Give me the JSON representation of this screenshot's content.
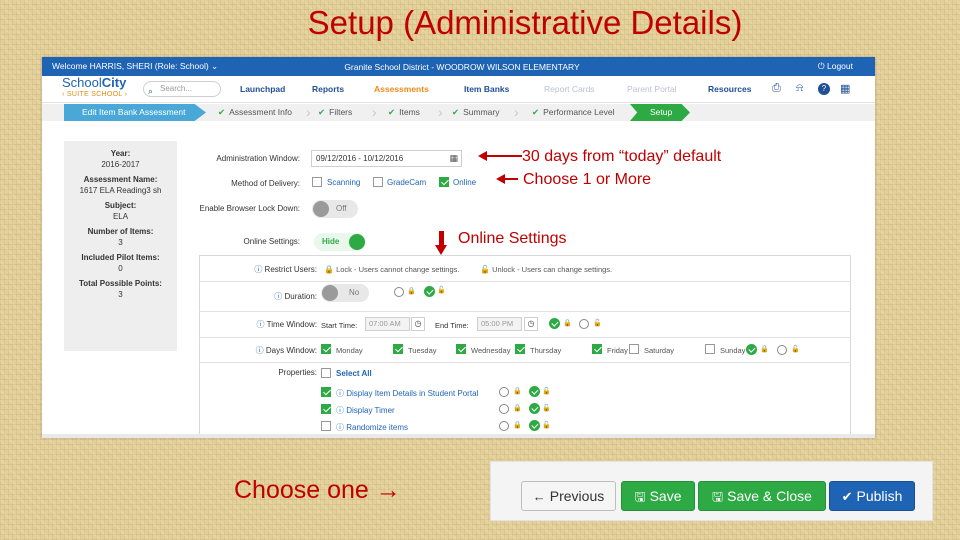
{
  "slide_title": "Setup (Administrative Details)",
  "topbar": {
    "welcome": "Welcome HARRIS, SHERI (Role: School) ⌄",
    "district": "Granite School District - WOODROW WILSON ELEMENTARY",
    "logout": "⏻ Logout"
  },
  "logo": {
    "line1a": "School",
    "line1b": "City",
    "line2": "‹ SUITE SCHOOL ›"
  },
  "search": {
    "placeholder": "Search..."
  },
  "nav": {
    "launchpad": "Launchpad",
    "reports": "Reports",
    "assessments": "Assessments",
    "item_banks": "Item Banks",
    "report_cards": "Report Cards",
    "parent_portal": "Parent Portal",
    "resources": "Resources"
  },
  "steps": {
    "edit": "Edit Item Bank Assessment",
    "assessment_info": "Assessment Info",
    "filters": "Filters",
    "items": "Items",
    "summary": "Summary",
    "performance_level": "Performance Level",
    "setup": "Setup",
    "check": "✔"
  },
  "summary": {
    "year_label": "Year:",
    "year": "2016-2017",
    "name_label": "Assessment Name:",
    "name": "1617 ELA Reading3 sh",
    "subject_label": "Subject:",
    "subject": "ELA",
    "items_label": "Number of Items:",
    "items": "3",
    "pilot_label": "Included Pilot Items:",
    "pilot": "0",
    "points_label": "Total Possible Points:",
    "points": "3"
  },
  "form": {
    "admin_window_label": "Administration Window:",
    "admin_window_value": "09/12/2016 - 10/12/2016",
    "delivery_label": "Method of Delivery:",
    "delivery_options": [
      "Scanning",
      "GradeCam",
      "Online"
    ],
    "delivery_checked": [
      false,
      false,
      true
    ],
    "browser_lock_label": "Enable Browser Lock Down:",
    "browser_lock_value": "Off",
    "online_settings_label": "Online Settings:",
    "online_settings_value": "Hide"
  },
  "online": {
    "restrict_label": "Restrict Users:",
    "restrict_lock_text": "Lock - Users cannot change settings.",
    "restrict_unlock_text": "Unlock - Users can change settings.",
    "duration_label": "Duration:",
    "duration_value": "No",
    "time_window_label": "Time Window:",
    "start_time_label": "Start Time:",
    "start_time_placeholder": "07:00 AM",
    "end_time_label": "End Time:",
    "end_time_placeholder": "05:00 PM",
    "days_window_label": "Days Window:",
    "days": [
      "Monday",
      "Tuesday",
      "Wednesday",
      "Thursday",
      "Friday",
      "Saturday",
      "Sunday"
    ],
    "days_checked": [
      true,
      true,
      true,
      true,
      true,
      false,
      false
    ],
    "properties_label": "Properties:",
    "properties": [
      "Select All",
      "Display Item Details in Student Portal",
      "Display Timer",
      "Randomize items"
    ],
    "properties_checked": [
      false,
      true,
      true,
      false
    ]
  },
  "annotations": {
    "default_note": "30 days from “today” default",
    "choose_note": "Choose 1 or More",
    "online_settings_note": "Online Settings",
    "choose_one": "Choose one →"
  },
  "buttons": {
    "previous": "Previous",
    "save": "Save",
    "save_close": "Save & Close",
    "publish": "Publish"
  },
  "colors": {
    "accent_blue": "#1f63b5",
    "accent_green": "#2eaa44",
    "annotation_red": "#c00000",
    "active_orange": "#f08a1a"
  }
}
